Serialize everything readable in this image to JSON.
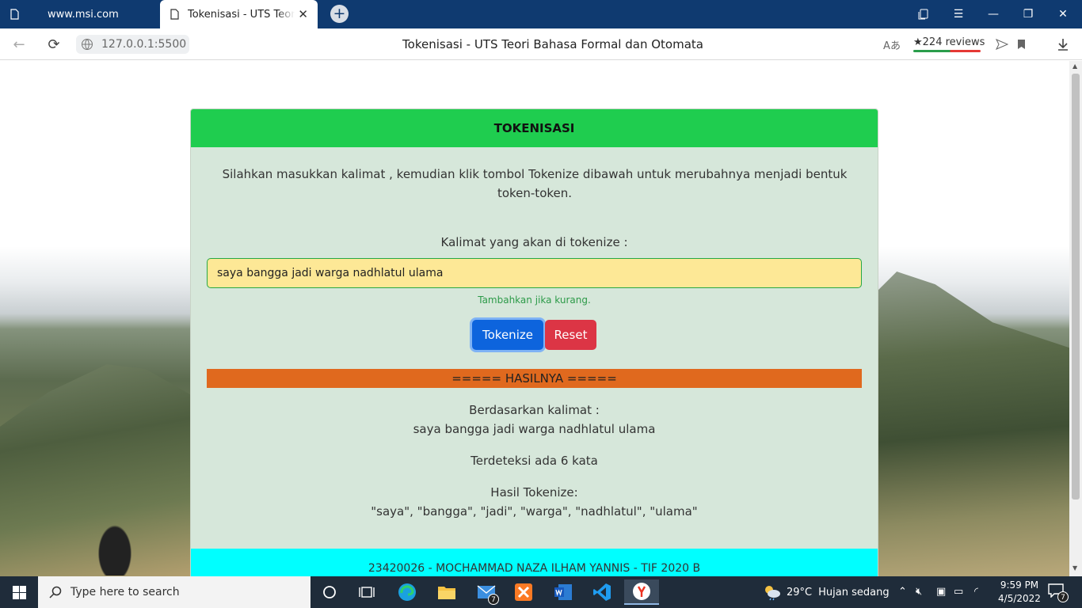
{
  "browser": {
    "tabs": [
      {
        "label": "www.msi.com",
        "active": false
      },
      {
        "label": "Tokenisasi - UTS Teori Bahasa Formal dan Otomata",
        "active": true
      }
    ],
    "new_tab_symbol": "+",
    "address": "127.0.0.1:5500",
    "page_title": "Tokenisasi - UTS Teori Bahasa Formal dan Otomata",
    "reviews": "★224 reviews",
    "icons": [
      "back-icon",
      "reload-icon",
      "globe-icon",
      "translate-icon",
      "share-icon",
      "bookmark-icon",
      "download-icon"
    ]
  },
  "card": {
    "header": "TOKENISASI",
    "intro": "Silahkan masukkan kalimat , kemudian klik tombol Tokenize dibawah untuk merubahnya menjadi bentuk token-token.",
    "input_label": "Kalimat yang akan di tokenize :",
    "input_value": "saya bangga jadi warga nadhlatul ulama",
    "hint": "Tambahkan jika kurang.",
    "tokenize_label": "Tokenize",
    "reset_label": "Reset",
    "result_header": "===== HASILNYA =====",
    "based_on_label": "Berdasarkan kalimat :",
    "based_on_value": "saya bangga jadi warga nadhlatul ulama",
    "word_count_text": "Terdeteksi ada 6 kata",
    "tokens_label": "Hasil Tokenize:",
    "tokens_value": "\"saya\", \"bangga\", \"jadi\", \"warga\", \"nadhlatul\", \"ulama\"",
    "footer": "23420026 - MOCHAMMAD NAZA ILHAM YANNIS - TIF 2020 B"
  },
  "colors": {
    "header_green": "#1fcd4f",
    "card_bg": "#d6e7da",
    "input_bg": "#fde896",
    "tokenize_blue": "#0d64dd",
    "reset_red": "#dc3545",
    "result_orange": "#e0691e",
    "footer_cyan": "#00ffff",
    "taskbar": "#1f2c3a"
  },
  "taskbar": {
    "search_placeholder": "Type here to search",
    "apps": [
      "cortana-icon",
      "task-view-icon",
      "edge-icon",
      "file-explorer-icon",
      "mail-icon",
      "xampp-icon",
      "word-icon",
      "vscode-icon",
      "yandex-browser-icon"
    ],
    "mail_badge": "7",
    "temperature": "29°C",
    "weather": "Hujan sedang",
    "time": "9:59 PM",
    "date": "4/5/2022",
    "notification_count": "7"
  }
}
